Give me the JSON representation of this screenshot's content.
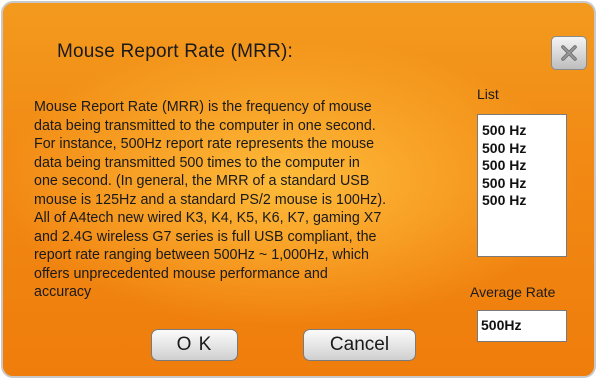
{
  "dialog": {
    "title": "Mouse Report Rate (MRR):",
    "close_icon": "close-icon",
    "description": "Mouse Report Rate (MRR) is the frequency of mouse\ndata being transmitted to the computer in one second.\nFor instance, 500Hz report rate represents the mouse\ndata being transmitted 500 times to the computer in\none second. (In general, the MRR of a standard USB\nmouse is 125Hz and a standard PS/2 mouse is 100Hz).\nAll of A4tech new wired K3, K4, K5, K6, K7, gaming X7\nand 2.4G wireless G7 series is full USB compliant, the\nreport rate ranging between 500Hz ~ 1,000Hz, which\noffers unprecedented mouse performance and\naccuracy"
  },
  "list": {
    "label": "List",
    "items": [
      "500 Hz",
      "500 Hz",
      "500 Hz",
      "500 Hz",
      "500 Hz"
    ]
  },
  "average": {
    "label": "Average Rate",
    "value": "500Hz"
  },
  "buttons": {
    "ok_label": "O K",
    "cancel_label": "Cancel"
  },
  "colors": {
    "background_accent": "#f28a14",
    "highlight": "#ffc040"
  }
}
